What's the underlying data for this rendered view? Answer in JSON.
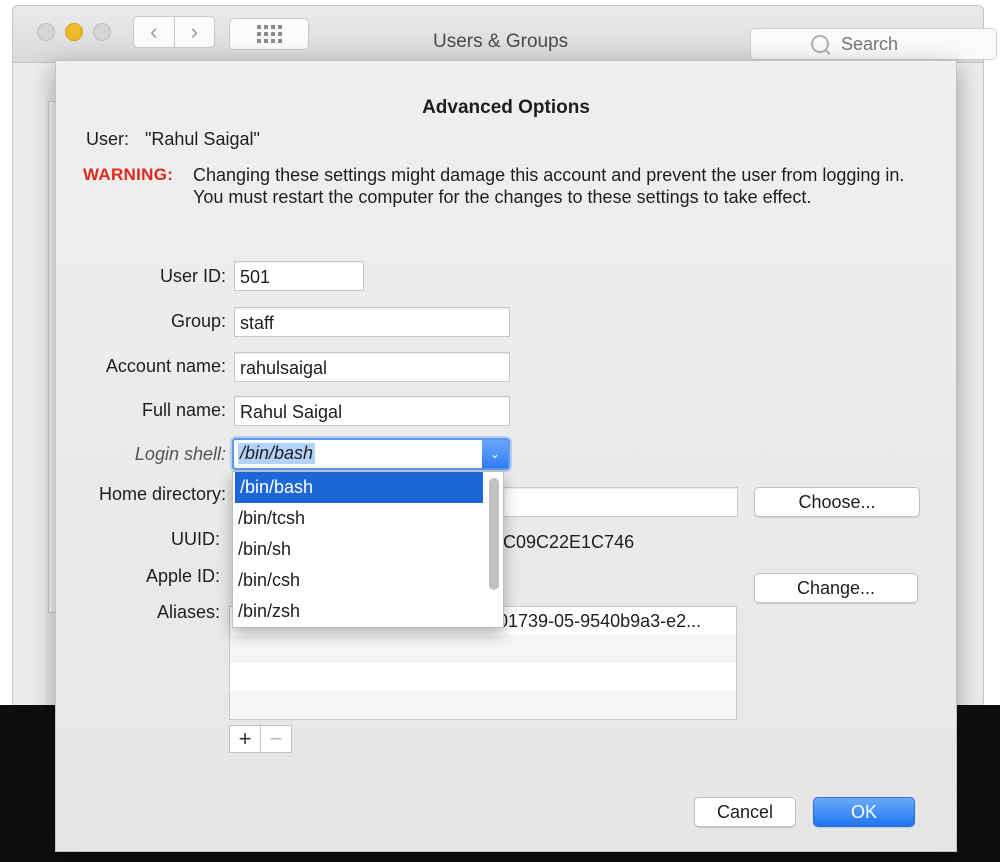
{
  "window": {
    "title": "Users & Groups",
    "search_placeholder": "Search",
    "back_label": "‹",
    "forward_label": "›"
  },
  "sheet": {
    "title": "Advanced Options",
    "user_label": "User:",
    "user_value": "\"Rahul Saigal\"",
    "warning_label": "WARNING:",
    "warning_text": "Changing these settings might damage this account and prevent the user from logging in. You must restart the computer for the changes to these settings to take effect."
  },
  "fields": {
    "user_id": {
      "label": "User ID:",
      "value": "501"
    },
    "group": {
      "label": "Group:",
      "value": "staff"
    },
    "account_name": {
      "label": "Account name:",
      "value": "rahulsaigal"
    },
    "full_name": {
      "label": "Full name:",
      "value": "Rahul Saigal"
    },
    "login_shell": {
      "label": "Login shell:",
      "value": "/bin/bash"
    },
    "home_directory": {
      "label": "Home directory:",
      "value": ""
    },
    "uuid": {
      "label": "UUID:",
      "value_visible": "C09C22E1C746"
    },
    "apple_id": {
      "label": "Apple ID:",
      "value": ""
    },
    "aliases": {
      "label": "Aliases:",
      "items": [
        "01739-05-9540b9a3-e2..."
      ]
    }
  },
  "login_shell_options": [
    "/bin/bash",
    "/bin/tcsh",
    "/bin/sh",
    "/bin/csh",
    "/bin/zsh"
  ],
  "buttons": {
    "choose": "Choose...",
    "change": "Change...",
    "add": "+",
    "remove": "−",
    "cancel": "Cancel",
    "ok": "OK"
  },
  "colors": {
    "warning": "#e0271d",
    "accent": "#1d67d8",
    "traffic_yellow": "#f2b72b"
  }
}
